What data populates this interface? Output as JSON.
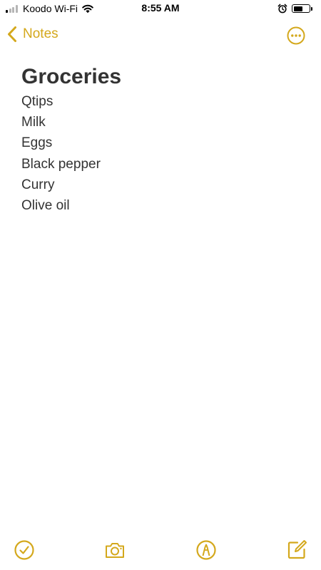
{
  "colors": {
    "accent": "#D4A81C",
    "text": "#333333",
    "status_text": "#000000"
  },
  "status_bar": {
    "carrier": "Koodo Wi-Fi",
    "time": "8:55 AM",
    "signal_bars_active": 1,
    "signal_bars_total": 4,
    "battery_level": 0.6,
    "icons": [
      "signal-icon",
      "wifi-icon",
      "alarm-icon",
      "battery-icon"
    ]
  },
  "nav": {
    "back_label": "Notes",
    "back_icon": "chevron-left-icon",
    "more_icon": "ellipsis-circle-icon"
  },
  "note": {
    "title": "Groceries",
    "lines": [
      "Qtips",
      "Milk",
      "Eggs",
      "Black pepper",
      "Curry",
      "Olive oil"
    ]
  },
  "toolbar": {
    "icons": [
      "checklist-icon",
      "camera-icon",
      "markup-icon",
      "compose-icon"
    ]
  }
}
